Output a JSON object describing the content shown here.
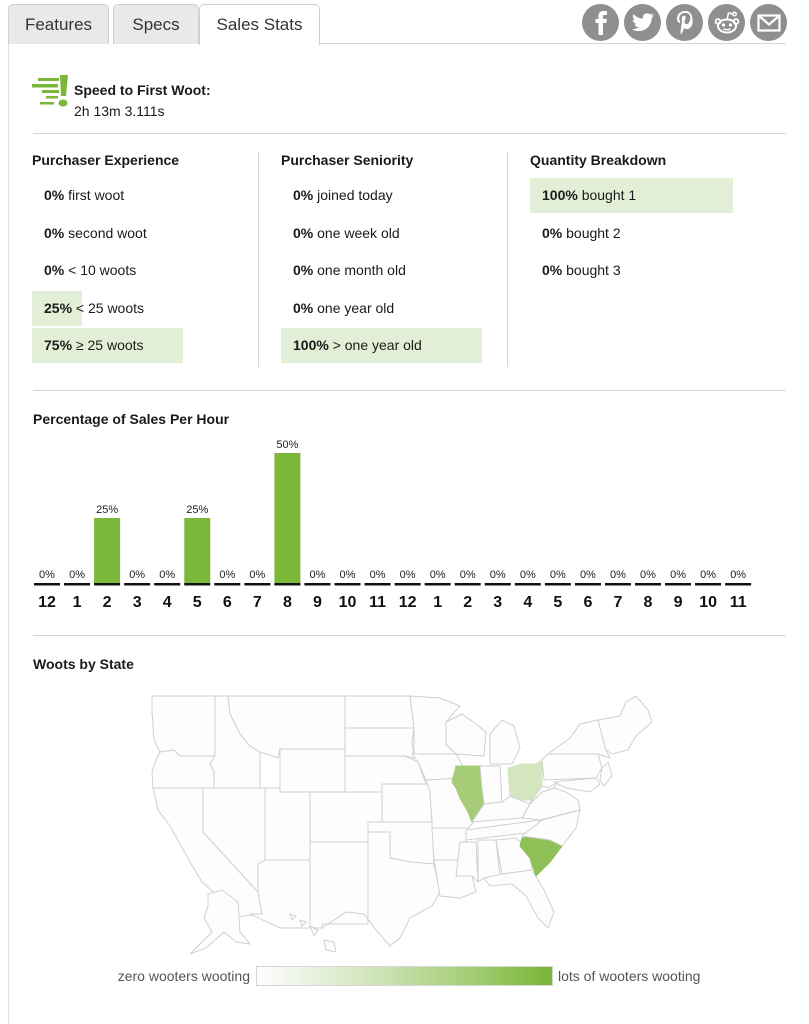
{
  "tabs": [
    {
      "label": "Features",
      "active": false
    },
    {
      "label": "Specs",
      "active": false
    },
    {
      "label": "Sales Stats",
      "active": true
    }
  ],
  "social": [
    {
      "name": "facebook-icon"
    },
    {
      "name": "twitter-icon"
    },
    {
      "name": "pinterest-icon"
    },
    {
      "name": "reddit-icon"
    },
    {
      "name": "email-icon"
    }
  ],
  "speed": {
    "title": "Speed to First Woot:",
    "value": "2h 13m 3.111s"
  },
  "colors": {
    "accent": "#7bb83a",
    "highlight": "#e2efd6",
    "icon_gray": "#8f8f8f"
  },
  "purchaser_experience": {
    "title": "Purchaser Experience",
    "rows": [
      {
        "pct": "0%",
        "label": "first woot",
        "value": 0
      },
      {
        "pct": "0%",
        "label": "second woot",
        "value": 0
      },
      {
        "pct": "0%",
        "label": "< 10 woots",
        "value": 0
      },
      {
        "pct": "25%",
        "label": "< 25 woots",
        "value": 25
      },
      {
        "pct": "75%",
        "label": "≥ 25 woots",
        "value": 75
      }
    ]
  },
  "purchaser_seniority": {
    "title": "Purchaser Seniority",
    "rows": [
      {
        "pct": "0%",
        "label": "joined today",
        "value": 0
      },
      {
        "pct": "0%",
        "label": "one week old",
        "value": 0
      },
      {
        "pct": "0%",
        "label": "one month old",
        "value": 0
      },
      {
        "pct": "0%",
        "label": "one year old",
        "value": 0
      },
      {
        "pct": "100%",
        "label": "> one year old",
        "value": 100
      }
    ]
  },
  "quantity_breakdown": {
    "title": "Quantity Breakdown",
    "rows": [
      {
        "pct": "100%",
        "label": "bought 1",
        "value": 100
      },
      {
        "pct": "0%",
        "label": "bought 2",
        "value": 0
      },
      {
        "pct": "0%",
        "label": "bought 3",
        "value": 0
      }
    ]
  },
  "chart_data": {
    "type": "bar",
    "title": "Percentage of Sales Per Hour",
    "xlabel": "",
    "ylabel": "",
    "ylim": [
      0,
      50
    ],
    "categories": [
      "12",
      "1",
      "2",
      "3",
      "4",
      "5",
      "6",
      "7",
      "8",
      "9",
      "10",
      "11",
      "12",
      "1",
      "2",
      "3",
      "4",
      "5",
      "6",
      "7",
      "8",
      "9",
      "10",
      "11"
    ],
    "values": [
      0,
      0,
      25,
      0,
      0,
      25,
      0,
      0,
      50,
      0,
      0,
      0,
      0,
      0,
      0,
      0,
      0,
      0,
      0,
      0,
      0,
      0,
      0,
      0
    ],
    "data_labels": [
      "0%",
      "0%",
      "25%",
      "0%",
      "0%",
      "25%",
      "0%",
      "0%",
      "50%",
      "0%",
      "0%",
      "0%",
      "0%",
      "0%",
      "0%",
      "0%",
      "0%",
      "0%",
      "0%",
      "0%",
      "0%",
      "0%",
      "0%",
      "0%"
    ],
    "grid": false
  },
  "map": {
    "title": "Woots by State",
    "highlighted_states": [
      {
        "state": "Illinois",
        "level": "medium",
        "color": "#a6cc78"
      },
      {
        "state": "Ohio",
        "level": "low",
        "color": "#d3e6bd"
      },
      {
        "state": "South Carolina",
        "level": "high",
        "color": "#8dc055"
      }
    ],
    "legend": {
      "low_label": "zero wooters wooting",
      "high_label": "lots of wooters wooting",
      "low_color": "#ffffff",
      "high_color": "#78b536"
    }
  }
}
